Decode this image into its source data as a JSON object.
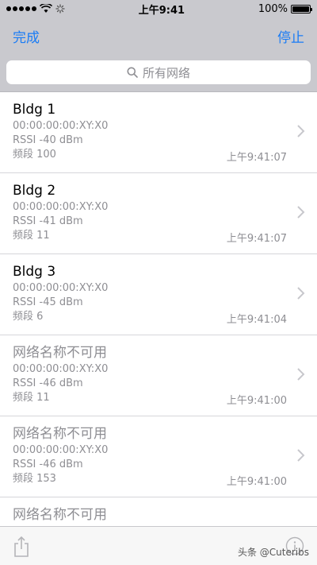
{
  "status": {
    "time": "上午9:41",
    "battery": "100%",
    "battery_level": 1.0
  },
  "nav": {
    "done_label": "完成",
    "stop_label": "停止"
  },
  "search": {
    "placeholder": "所有网络"
  },
  "networks": [
    {
      "name": "Bldg 1",
      "mac": "00:00:00:00:XY:X0",
      "rssi": "RSSI -40 dBm",
      "band": "频段 100",
      "time": "上午9:41:07",
      "available": true
    },
    {
      "name": "Bldg 2",
      "mac": "00:00:00:00:XY:X0",
      "rssi": "RSSI -41 dBm",
      "band": "频段 11",
      "time": "上午9:41:07",
      "available": true
    },
    {
      "name": "Bldg 3",
      "mac": "00:00:00:00:XY:X0",
      "rssi": "RSSI -45 dBm",
      "band": "频段 6",
      "time": "上午9:41:04",
      "available": true
    },
    {
      "name": "网络名称不可用",
      "mac": "00:00:00:00:XY:X0",
      "rssi": "RSSI -46 dBm",
      "band": "频段 11",
      "time": "上午9:41:00",
      "available": false
    },
    {
      "name": "网络名称不可用",
      "mac": "00:00:00:00:XY:X0",
      "rssi": "RSSI -46 dBm",
      "band": "频段 153",
      "time": "上午9:41:00",
      "available": false
    },
    {
      "name": "网络名称不可用",
      "available": false
    }
  ],
  "watermark": "头条 @Cuteribs",
  "colors": {
    "accent": "#1a7cf5",
    "bar_bg": "#c9c9ce",
    "muted_text": "#8e8e93"
  }
}
